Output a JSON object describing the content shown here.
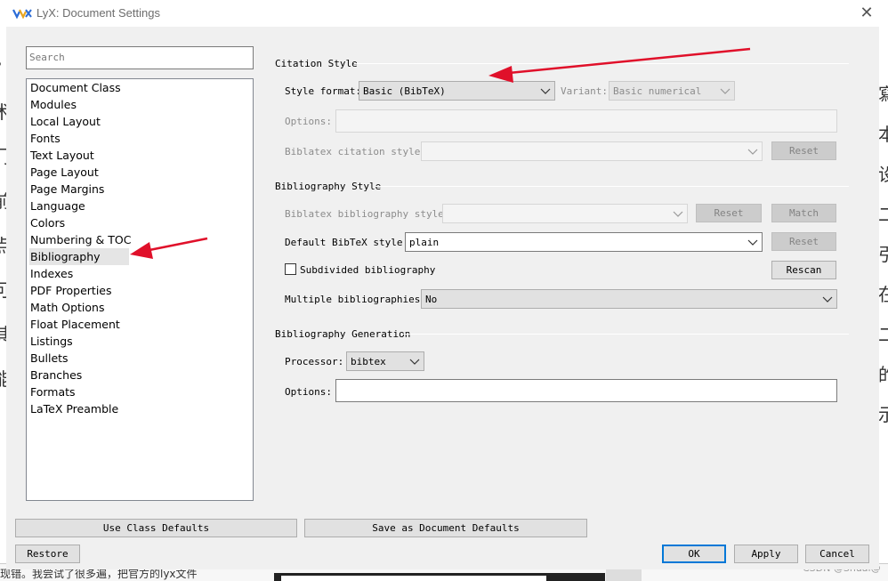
{
  "window": {
    "title": "LyX: Document Settings",
    "close_glyph": "✕"
  },
  "background": {
    "bottom_text": "现错。我尝试了很多遍，把官方的lyx文件",
    "watermark": "CSDN @Shuai@",
    "left_glyphs": [
      "•",
      "术",
      "门",
      "前",
      "点",
      "可",
      "其",
      "能",
      "·"
    ],
    "right_glyphs": [
      "寫",
      "本",
      "设",
      "二",
      "引",
      "在",
      "二",
      "的",
      "示"
    ]
  },
  "sidebar": {
    "search_placeholder": "Search",
    "items": [
      {
        "label": "Document Class"
      },
      {
        "label": "Modules"
      },
      {
        "label": "Local Layout"
      },
      {
        "label": "Fonts"
      },
      {
        "label": "Text Layout"
      },
      {
        "label": "Page Layout"
      },
      {
        "label": "Page Margins"
      },
      {
        "label": "Language"
      },
      {
        "label": "Colors"
      },
      {
        "label": "Numbering & TOC"
      },
      {
        "label": "Bibliography",
        "selected": true
      },
      {
        "label": "Indexes"
      },
      {
        "label": "PDF Properties"
      },
      {
        "label": "Math Options"
      },
      {
        "label": "Float Placement"
      },
      {
        "label": "Listings"
      },
      {
        "label": "Bullets"
      },
      {
        "label": "Branches"
      },
      {
        "label": "Formats"
      },
      {
        "label": "LaTeX Preamble"
      }
    ]
  },
  "citation": {
    "title": "Citation Style",
    "style_format_label": "Style format:",
    "style_format_value": "Basic (BibTeX)",
    "variant_label": "Variant:",
    "variant_value": "Basic numerical",
    "options_label": "Options:",
    "biblatex_citation_label": "Biblatex citation style:",
    "reset_label": "Reset"
  },
  "bibliography": {
    "title": "Bibliography Style",
    "biblatex_bib_label": "Biblatex bibliography style:",
    "reset_label": "Reset",
    "match_label": "Match",
    "default_bibtex_label": "Default BibTeX style:",
    "default_bibtex_value": "plain",
    "reset2_label": "Reset",
    "subdivided_label": "Subdivided bibliography",
    "subdivided_checked": false,
    "rescan_label": "Rescan",
    "multiple_label": "Multiple bibliographies:",
    "multiple_value": "No"
  },
  "generation": {
    "title": "Bibliography Generation",
    "processor_label": "Processor:",
    "processor_value": "bibtex",
    "options_label": "Options:",
    "options_value": ""
  },
  "footer": {
    "use_class_defaults": "Use Class Defaults",
    "save_as_defaults": "Save as Document Defaults",
    "restore": "Restore",
    "ok": "OK",
    "apply": "Apply",
    "cancel": "Cancel"
  },
  "colors": {
    "arrow_red": "#e0102a",
    "selection_bg": "#e5e5e5",
    "default_button_border": "#0078d7"
  }
}
